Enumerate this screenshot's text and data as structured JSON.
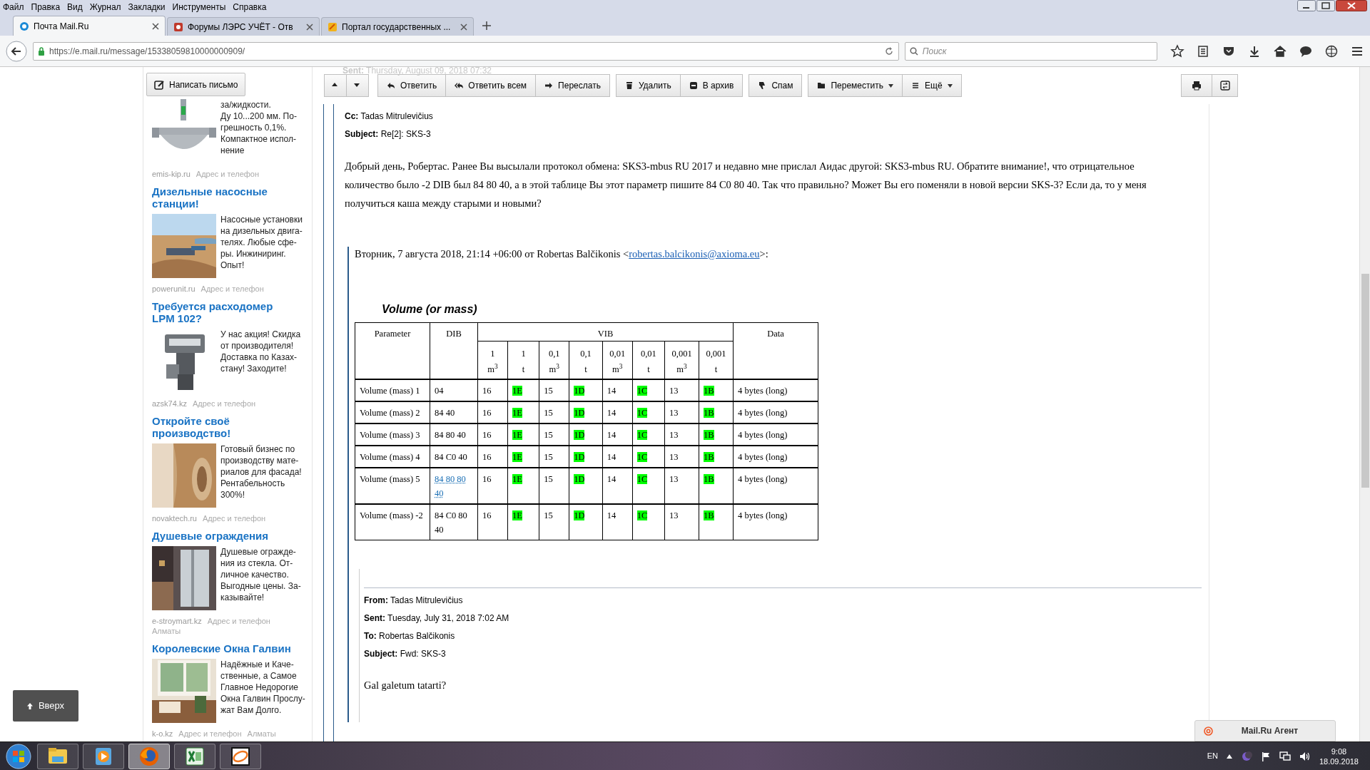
{
  "menu": [
    "Файл",
    "Правка",
    "Вид",
    "Журнал",
    "Закладки",
    "Инструменты",
    "Справка"
  ],
  "tabs": [
    {
      "label": "Почта Mail.Ru",
      "selected": true
    },
    {
      "label": "Форумы ЛЭРС УЧЁТ - Отв",
      "selected": false
    },
    {
      "label": "Портал государственных ...",
      "selected": false
    }
  ],
  "address": {
    "url": "https://e.mail.ru/message/15338059810000000909/"
  },
  "search": {
    "placeholder": "Поиск"
  },
  "compose_button": "Написать письмо",
  "toolbar": [
    [
      {
        "kind": "up",
        "dropdown": false
      },
      {
        "kind": "down",
        "dropdown": false
      }
    ],
    [
      {
        "label": "Ответить",
        "kind": "reply",
        "dropdown": false
      },
      {
        "label": "Ответить всем",
        "kind": "reply-all",
        "dropdown": false
      },
      {
        "label": "Переслать",
        "kind": "forward",
        "dropdown": false
      }
    ],
    [
      {
        "label": "Удалить",
        "kind": "delete",
        "dropdown": false
      },
      {
        "label": "В архив",
        "kind": "archive",
        "dropdown": false
      }
    ],
    [
      {
        "label": "Спам",
        "kind": "spam",
        "dropdown": false
      }
    ],
    [
      {
        "label": "Переместить",
        "kind": "folder",
        "dropdown": true
      },
      {
        "label": "Ещё",
        "kind": "more",
        "dropdown": true
      }
    ]
  ],
  "ads": [
    {
      "lines": [
        "за/жидкости.",
        "Ду 10...200 мм. По-",
        "грешность 0,1%.",
        "Компактное испол-",
        "нение"
      ],
      "domain": "emis-kip.ru",
      "contact": "Адрес и телефон"
    },
    {
      "title": "Дизельные насосные станции!",
      "lines": [
        "Насосные установки",
        "на дизельных двига-",
        "телях. Любые сфе-",
        "ры. Инжиниринг.",
        "Опыт!"
      ],
      "domain": "powerunit.ru",
      "contact": "Адрес и телефон"
    },
    {
      "title": "Требуется расходомер LPM 102?",
      "lines": [
        "У нас акция! Скидка",
        "от производителя!",
        "Доставка по Казах-",
        "стану! Заходите!"
      ],
      "domain": "azsk74.kz",
      "contact": "Адрес и телефон"
    },
    {
      "title": "Откройте своё производство!",
      "lines": [
        "Готовый бизнес по",
        "производству мате-",
        "риалов для фасада!",
        "Рентабельность",
        "300%!"
      ],
      "domain": "novaktech.ru",
      "contact": "Адрес и телефон"
    },
    {
      "title": "Душевые ограждения",
      "lines": [
        "Душевые огражде-",
        "ния из стекла. От-",
        "личное качество.",
        "Выгодные цены. За-",
        "казывайте!"
      ],
      "domain": "e-stroymart.kz",
      "contact": "Адрес и телефон",
      "city": "Алматы"
    },
    {
      "title": "Королевские Окна Галвин",
      "lines": [
        "Надёжные и Каче-",
        "ственные, а Самое",
        "Главное Недорогие",
        "Окна Галвин Прослу-",
        "жат Вам Долго."
      ],
      "domain": "k-o.kz",
      "contact": "Адрес и телефон",
      "city": "Алматы"
    }
  ],
  "email": {
    "hidden_header": {
      "label": "Sent:",
      "value": "Thursday, August 09, 2018 07:32"
    },
    "headers": [
      {
        "label": "Cc:",
        "value": "Tadas Mitrulevičius"
      },
      {
        "label": "Subject:",
        "value": "Re[2]: SKS-3"
      }
    ],
    "body": "Добрый день, Робертас. Ранее Вы высылали протокол обмена: SKS3-mbus RU 2017 и недавно мне прислал Аидас другой: SKS3-mbus RU. Обратите внимание!, что отрицательное количество было -2 DIB был 84 80 40, а в этой таблице Вы этот параметр пишите 84 C0 80 40. Так что правильно? Может Вы его поменяли в новой версии SKS-3? Если да, то у меня получиться каша между старыми и новыми?",
    "quote": {
      "before": "Вторник, 7 августа 2018, 21:14 +06:00 от Robertas Balčikonis <",
      "link": "robertas.balcikonis@axioma.eu",
      "after": ">:"
    },
    "table": {
      "title": "Volume (or mass)",
      "columns": [
        "Parameter",
        "DIB",
        "VIB",
        "Data"
      ],
      "units": [
        {
          "value": "1",
          "unit": "m$^{3}$"
        },
        {
          "value": "1",
          "unit": "t"
        },
        {
          "value": "0,1",
          "unit": "m$^{3}$"
        },
        {
          "value": "0,1",
          "unit": "t"
        },
        {
          "value": "0,01",
          "unit": "m$^{3}$"
        },
        {
          "value": "0,01",
          "unit": "t"
        },
        {
          "value": "0,001",
          "unit": "m$^{3}$"
        },
        {
          "value": "0,001",
          "unit": "t"
        }
      ],
      "rows": [
        {
          "parameter": "Volume (mass) 1",
          "dib": "04",
          "dib_link": false,
          "vib": [
            {
              "text": "16",
              "highlighted": false
            },
            {
              "text": "1E",
              "highlighted": true
            },
            {
              "text": "15",
              "highlighted": false
            },
            {
              "text": "1D",
              "highlighted": true
            },
            {
              "text": "14",
              "highlighted": false
            },
            {
              "text": "1C",
              "highlighted": true
            },
            {
              "text": "13",
              "highlighted": false
            },
            {
              "text": "1B",
              "highlighted": true
            }
          ],
          "data": "4 bytes (long)"
        },
        {
          "parameter": "Volume (mass) 2",
          "dib": "84 40",
          "dib_link": false,
          "vib": [
            {
              "text": "16",
              "highlighted": false
            },
            {
              "text": "1E",
              "highlighted": true
            },
            {
              "text": "15",
              "highlighted": false
            },
            {
              "text": "1D",
              "highlighted": true
            },
            {
              "text": "14",
              "highlighted": false
            },
            {
              "text": "1C",
              "highlighted": true
            },
            {
              "text": "13",
              "highlighted": false
            },
            {
              "text": "1B",
              "highlighted": true
            }
          ],
          "data": "4 bytes (long)"
        },
        {
          "parameter": "Volume (mass) 3",
          "dib": "84 80 40",
          "dib_link": false,
          "vib": [
            {
              "text": "16",
              "highlighted": false
            },
            {
              "text": "1E",
              "highlighted": true
            },
            {
              "text": "15",
              "highlighted": false
            },
            {
              "text": "1D",
              "highlighted": true
            },
            {
              "text": "14",
              "highlighted": false
            },
            {
              "text": "1C",
              "highlighted": true
            },
            {
              "text": "13",
              "highlighted": false
            },
            {
              "text": "1B",
              "highlighted": true
            }
          ],
          "data": "4 bytes (long)"
        },
        {
          "parameter": "Volume (mass) 4",
          "dib": "84 C0 40",
          "dib_link": false,
          "vib": [
            {
              "text": "16",
              "highlighted": false
            },
            {
              "text": "1E",
              "highlighted": true
            },
            {
              "text": "15",
              "highlighted": false
            },
            {
              "text": "1D",
              "highlighted": true
            },
            {
              "text": "14",
              "highlighted": false
            },
            {
              "text": "1C",
              "highlighted": true
            },
            {
              "text": "13",
              "highlighted": false
            },
            {
              "text": "1B",
              "highlighted": true
            }
          ],
          "data": "4 bytes (long)"
        },
        {
          "parameter": "Volume (mass) 5",
          "dib": "84 80 80 40",
          "dib_link": true,
          "vib": [
            {
              "text": "16",
              "highlighted": false
            },
            {
              "text": "1E",
              "highlighted": true
            },
            {
              "text": "15",
              "highlighted": false
            },
            {
              "text": "1D",
              "highlighted": true
            },
            {
              "text": "14",
              "highlighted": false
            },
            {
              "text": "1C",
              "highlighted": true
            },
            {
              "text": "13",
              "highlighted": false
            },
            {
              "text": "1B",
              "highlighted": true
            }
          ],
          "data": "4 bytes (long)"
        },
        {
          "parameter": "Volume (mass) -2",
          "dib": "84 C0 80 40",
          "dib_link": false,
          "vib": [
            {
              "text": "16",
              "highlighted": false
            },
            {
              "text": "1E",
              "highlighted": true
            },
            {
              "text": "15",
              "highlighted": false
            },
            {
              "text": "1D",
              "highlighted": true
            },
            {
              "text": "14",
              "highlighted": false
            },
            {
              "text": "1C",
              "highlighted": true
            },
            {
              "text": "13",
              "highlighted": false
            },
            {
              "text": "1B",
              "highlighted": true
            }
          ],
          "data": "4 bytes (long)"
        }
      ]
    },
    "forwarded": {
      "headers": [
        {
          "label": "From:",
          "value": "Tadas Mitrulevičius"
        },
        {
          "label": "Sent:",
          "value": "Tuesday, July 31, 2018 7:02 AM"
        },
        {
          "label": "To:",
          "value": "Robertas Balčikonis"
        },
        {
          "label": "Subject:",
          "value": "Fwd: SKS-3"
        }
      ],
      "body": "Gal galetum tatarti?"
    }
  },
  "back_to_top": "Вверх",
  "agent": "Mail.Ru Агент",
  "taskbar": {
    "apps": [
      {
        "kind": "explorer",
        "active": false
      },
      {
        "kind": "media",
        "active": false
      },
      {
        "kind": "firefox",
        "active": true
      },
      {
        "kind": "excel",
        "active": false
      },
      {
        "kind": "agent",
        "active": false
      }
    ],
    "language": "EN",
    "time": "9:08",
    "date": "18.09.2018"
  }
}
